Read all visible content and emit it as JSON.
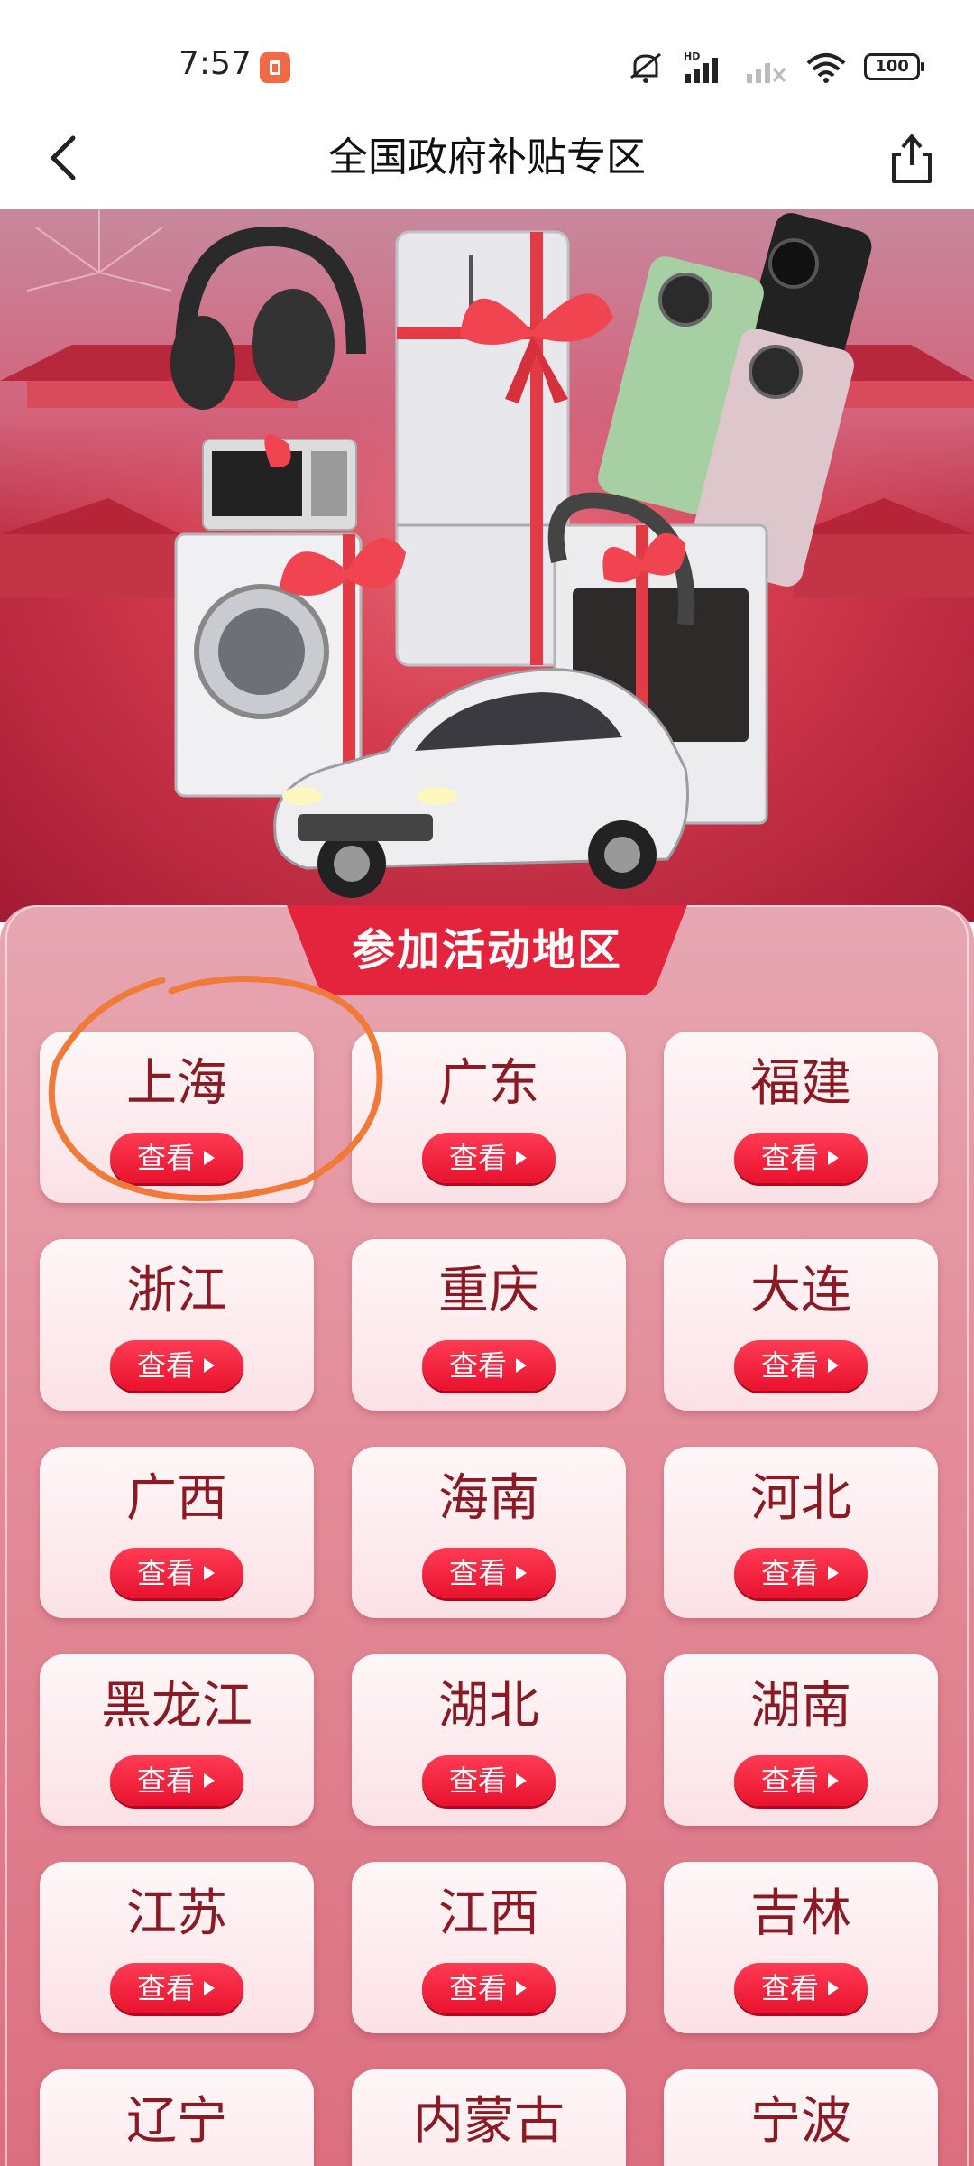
{
  "status_bar": {
    "time": "7:57",
    "battery": "100",
    "icons": [
      "app-notification-icon",
      "mute-icon",
      "hd-signal-icon",
      "signal-icon",
      "wifi-icon",
      "battery-icon"
    ]
  },
  "header": {
    "title": "全国政府补贴专区",
    "back_icon": "chevron-left-icon",
    "share_icon": "share-icon"
  },
  "panel": {
    "title": "参加活动地区",
    "button_label": "查看",
    "regions": [
      {
        "name": "上海"
      },
      {
        "name": "广东"
      },
      {
        "name": "福建"
      },
      {
        "name": "浙江"
      },
      {
        "name": "重庆"
      },
      {
        "name": "大连"
      },
      {
        "name": "广西"
      },
      {
        "name": "海南"
      },
      {
        "name": "河北"
      },
      {
        "name": "黑龙江"
      },
      {
        "name": "湖北"
      },
      {
        "name": "湖南"
      },
      {
        "name": "江苏"
      },
      {
        "name": "江西"
      },
      {
        "name": "吉林"
      },
      {
        "name": "辽宁"
      },
      {
        "name": "内蒙古"
      },
      {
        "name": "宁波"
      }
    ]
  },
  "colors": {
    "accent": "#e8122e",
    "region_text": "#8b1a24",
    "annotation": "#f07a3a"
  }
}
